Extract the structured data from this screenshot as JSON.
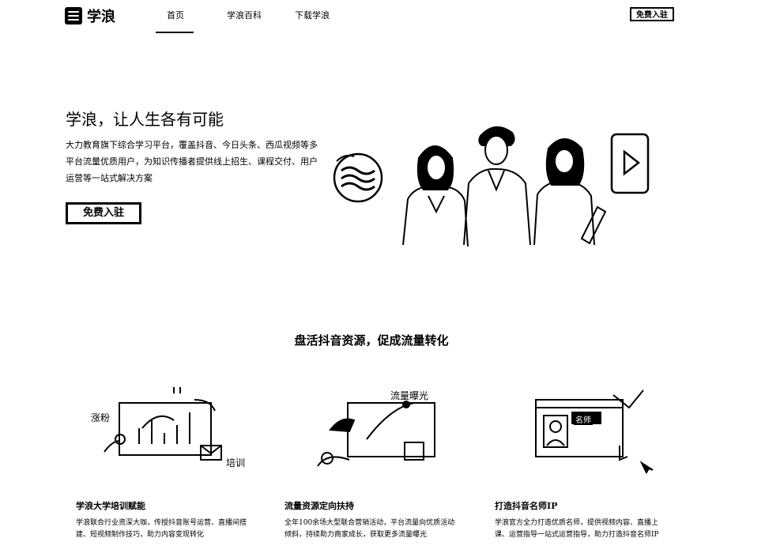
{
  "header": {
    "logo_text": "学浪",
    "nav": [
      "首页",
      "学浪百科",
      "下载学浪"
    ],
    "join_label": "免费入驻"
  },
  "hero": {
    "title": "学浪，让人生各有可能",
    "description": "大力教育旗下综合学习平台，覆盖抖音、今日头条、西瓜视频等多平台流量优质用户，为知识传播者提供线上招生、课程交付、用户运营等一站式解决方案",
    "cta_label": "免费入驻"
  },
  "section": {
    "title": "盘活抖音资源，促成流量转化",
    "features": [
      {
        "title": "学浪大学培训赋能",
        "description": "学浪联合行业资深大咖，传授抖音账号运营、直播间搭建、短视频制作技巧，助力内容变现转化",
        "labels": [
          "涨粉",
          "培训"
        ]
      },
      {
        "title": "流量资源定向扶持",
        "description": "全年100余场大型联合营销活动，平台流量向优质活动倾斜，持续助力商家成长，获取更多流量曝光",
        "labels": [
          "流量曝光"
        ]
      },
      {
        "title": "打造抖音名师IP",
        "description": "学浪官方全力打造优质名师，提供视频内容、直播上课、运营指导一站式运营指导，助力打造抖音名师IP",
        "labels": [
          "名师"
        ]
      }
    ]
  },
  "colors": {
    "foreground": "#000000",
    "background": "#ffffff"
  }
}
